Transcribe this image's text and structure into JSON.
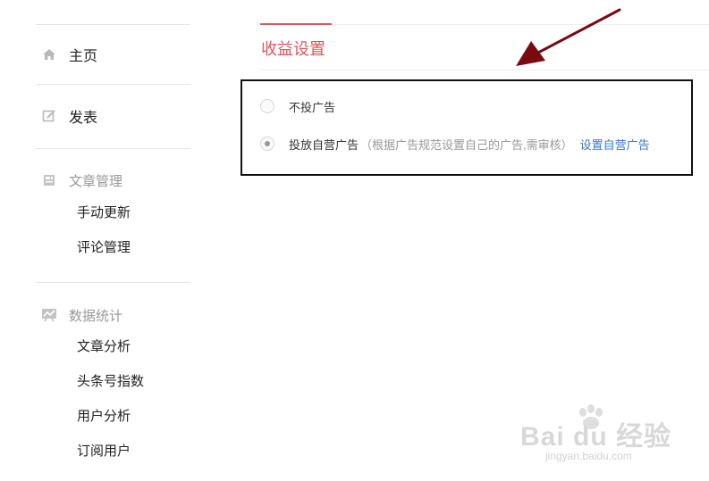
{
  "sidebar": {
    "home": {
      "label": "主页",
      "icon": "home-icon"
    },
    "publish": {
      "label": "发表",
      "icon": "edit-icon"
    },
    "articles": {
      "label": "文章管理",
      "icon": "document-icon",
      "items": [
        "手动更新",
        "评论管理"
      ]
    },
    "stats": {
      "label": "数据统计",
      "icon": "chart-icon",
      "items": [
        "文章分析",
        "头条号指数",
        "用户分析",
        "订阅用户"
      ]
    }
  },
  "main": {
    "title": "收益设置",
    "options": [
      {
        "label": "不投广告",
        "checked": false
      },
      {
        "label": "投放自营广告",
        "note": "（根据广告规范设置自己的广告,需审核）",
        "link": "设置自营广告",
        "checked": true
      }
    ]
  },
  "watermark": {
    "brand": "Bai du 经验",
    "url": "jingyan.baidu.com"
  },
  "colors": {
    "accent": "#e1555a",
    "link": "#3a78c4",
    "annotation": "#7a0a10"
  }
}
